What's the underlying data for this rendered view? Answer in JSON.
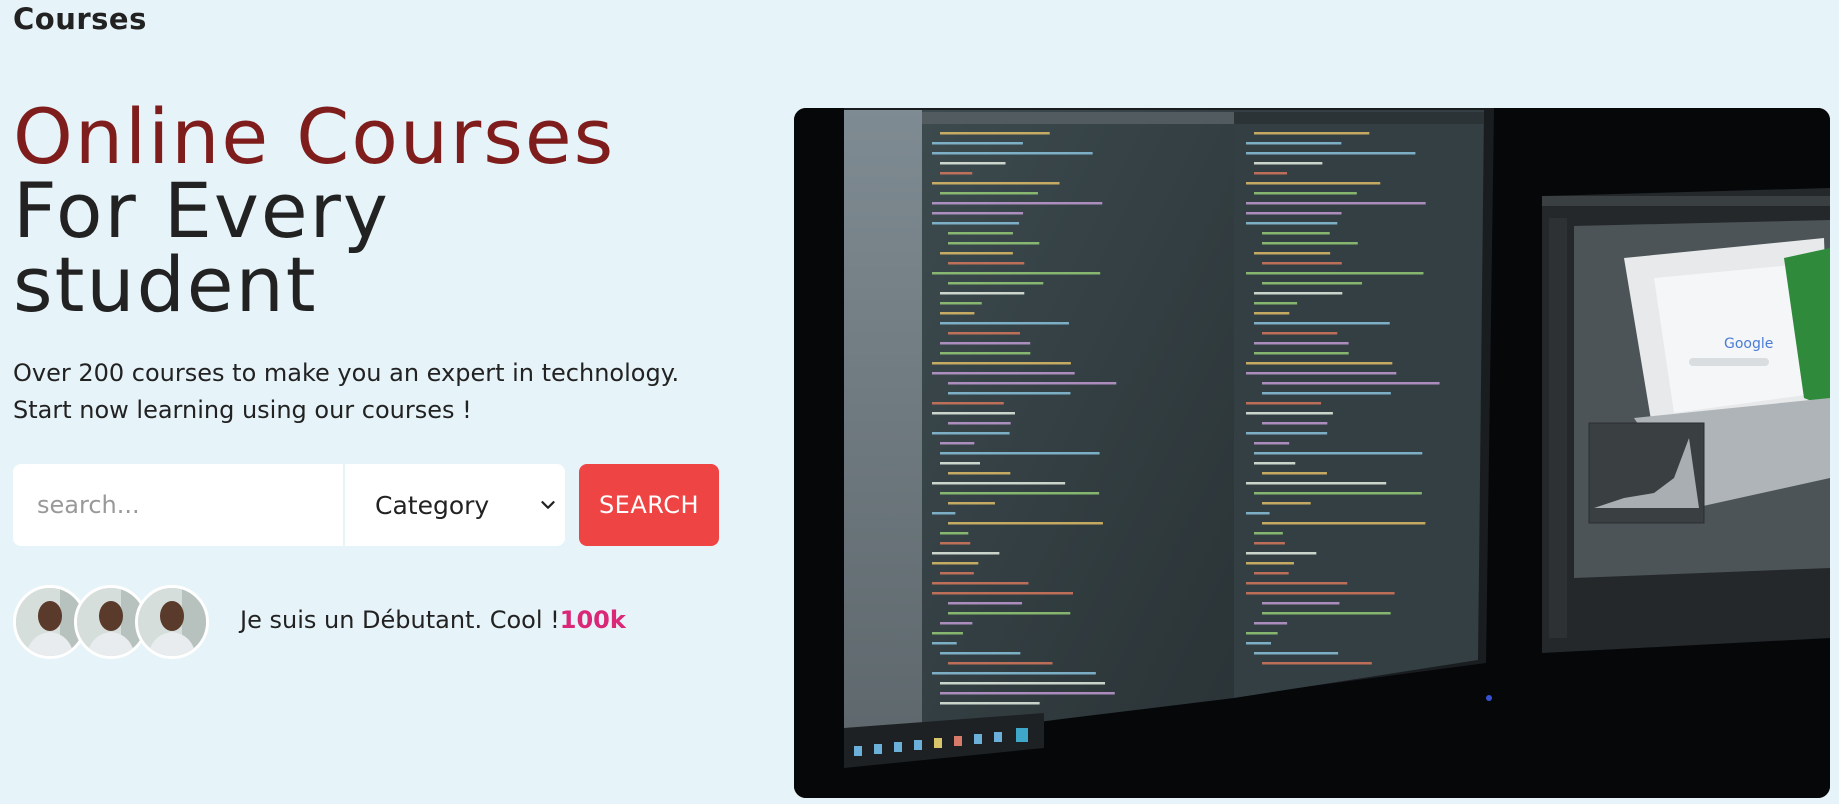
{
  "header": {
    "brand": "Courses"
  },
  "hero": {
    "title_accent": "Online Courses",
    "title_line2": "For Every",
    "title_line3": "student",
    "description_line1": "Over 200 courses to make you an expert in technology.",
    "description_line2": "Start now learning using our courses !"
  },
  "search": {
    "placeholder": "search...",
    "category_selected": "Category",
    "button_label": "SEARCH"
  },
  "community": {
    "text": "Je suis un Débutant. Cool !",
    "count": "100k"
  },
  "image": {
    "description_icon": "monitor-with-code-image",
    "browser_logo_text": "Google"
  },
  "colors": {
    "accent_red": "#7f1d1d",
    "button_red": "#ef4444",
    "count_pink": "#db2777",
    "background": "#e6f3f8"
  }
}
